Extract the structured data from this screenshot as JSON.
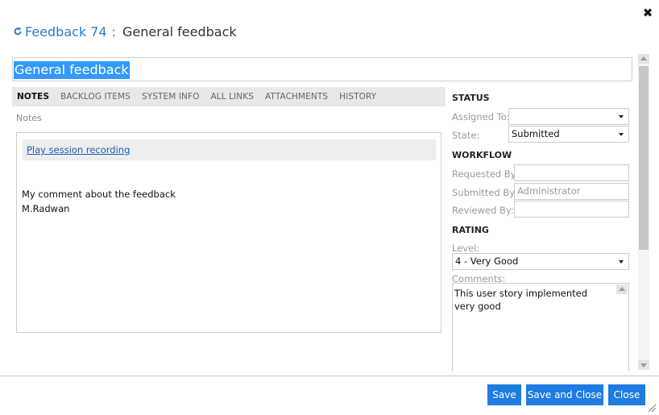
{
  "header": {
    "work_item_link": "Feedback 74",
    "separator": ":",
    "title": "General feedback",
    "icons": {
      "refresh": "refresh-icon",
      "close": "close-icon"
    },
    "link_color": "#2b7bd3"
  },
  "title_field": {
    "value": "General feedback",
    "selected": true
  },
  "tabs": [
    {
      "label": "NOTES",
      "active": true
    },
    {
      "label": "BACKLOG ITEMS"
    },
    {
      "label": "SYSTEM INFO"
    },
    {
      "label": "ALL LINKS"
    },
    {
      "label": "ATTACHMENTS"
    },
    {
      "label": "HISTORY"
    }
  ],
  "notes": {
    "label": "Notes",
    "play_link": "Play session recording",
    "lines": [
      "My comment about the feedback",
      "M.Radwan"
    ]
  },
  "status": {
    "heading": "STATUS",
    "assigned_to": {
      "label": "Assigned To:",
      "value": ""
    },
    "state": {
      "label": "State:",
      "value": "Submitted"
    }
  },
  "workflow": {
    "heading": "WORKFLOW",
    "requested_by": {
      "label": "Requested By:",
      "value": ""
    },
    "submitted_by": {
      "label": "Submitted By:",
      "value": "Administrator"
    },
    "reviewed_by": {
      "label": "Reviewed By:",
      "value": ""
    }
  },
  "rating": {
    "heading": "RATING",
    "level": {
      "label": "Level:",
      "value": "4 - Very Good"
    },
    "comments": {
      "label": "Comments:",
      "value": "This user story implemented very good"
    }
  },
  "footer": {
    "save": "Save",
    "save_close": "Save and Close",
    "close": "Close",
    "button_color": "#1f7ce0"
  }
}
